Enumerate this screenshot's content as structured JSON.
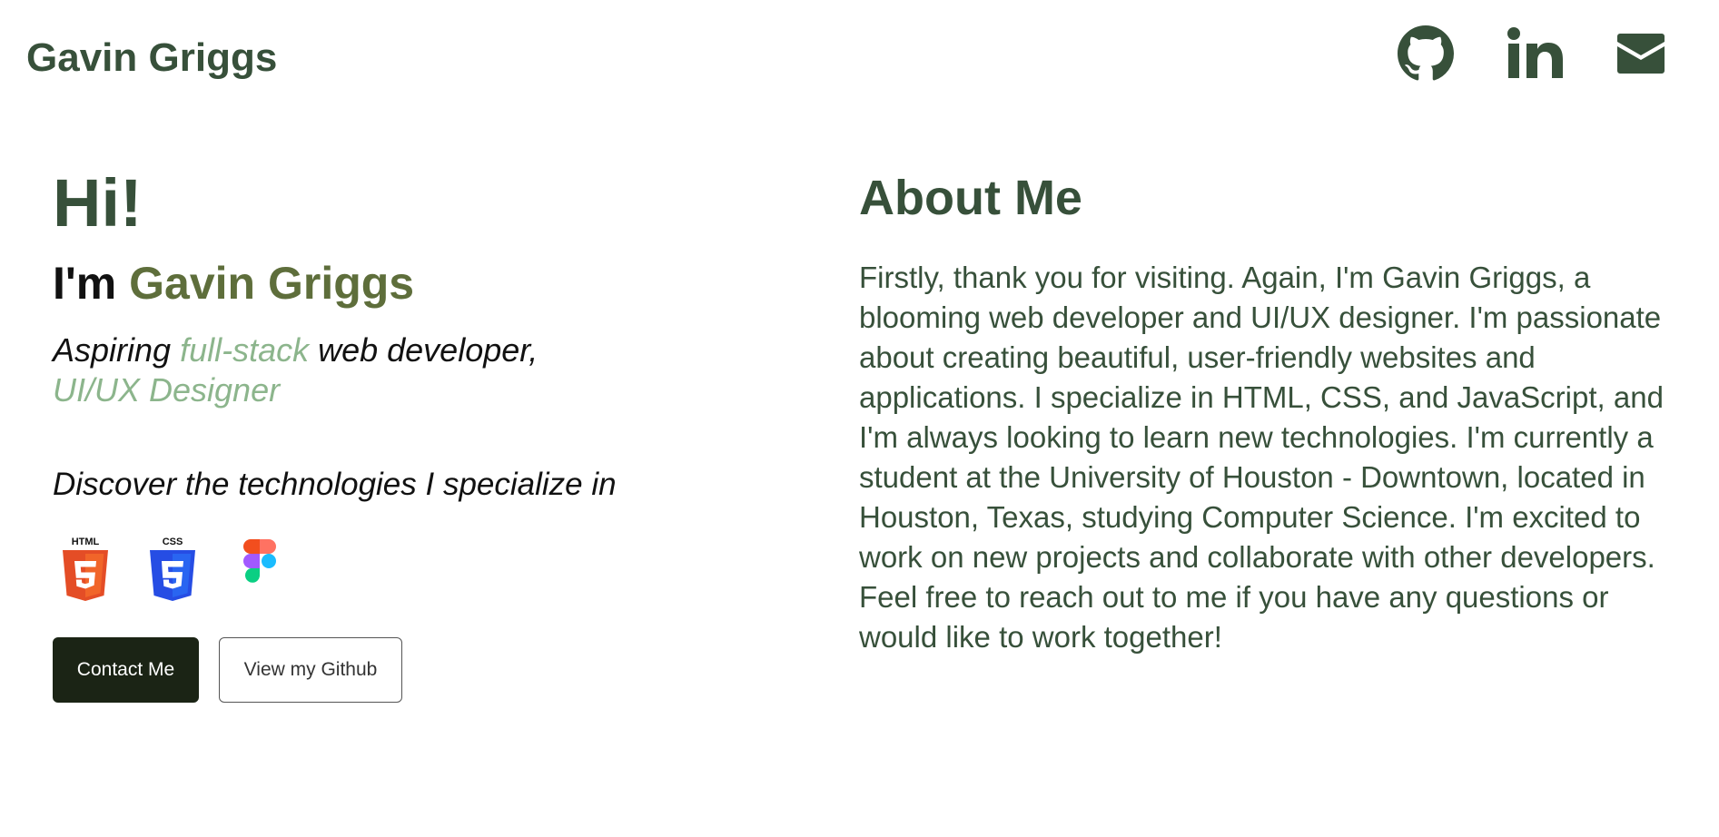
{
  "header": {
    "brand": "Gavin Griggs",
    "social": [
      {
        "icon": "github-icon",
        "label": "GitHub"
      },
      {
        "icon": "linkedin-icon",
        "label": "LinkedIn"
      },
      {
        "icon": "mail-icon",
        "label": "Email"
      }
    ]
  },
  "hero": {
    "greeting": "Hi!",
    "intro_prefix": "I'm ",
    "intro_name": "Gavin Griggs",
    "tagline_part1": "Aspiring ",
    "tagline_highlight": "full-stack",
    "tagline_part2": " web developer,",
    "tagline_line2": "UI/UX Designer",
    "discover": "Discover the technologies I specialize in",
    "technologies": [
      {
        "icon": "html5-icon",
        "label": "HTML"
      },
      {
        "icon": "css3-icon",
        "label": "CSS"
      },
      {
        "icon": "figma-icon",
        "label": "Figma"
      }
    ],
    "contact_button": "Contact Me",
    "github_button": "View my Github"
  },
  "about": {
    "title": "About Me",
    "body": "Firstly, thank you for visiting. Again, I'm Gavin Griggs, a blooming web developer and UI/UX designer. I'm passionate about creating beautiful, user-friendly websites and applications. I specialize in HTML, CSS, and JavaScript, and I'm always looking to learn new technologies. I'm currently a student at the University of Houston - Downtown, located in Houston, Texas, studying Computer Science. I'm excited to work on new projects and collaborate with other developers. Feel free to reach out to me if you have any questions or would like to work together!"
  },
  "colors": {
    "primary_green": "#37503a",
    "name_olive": "#5e6e3b",
    "light_green": "#8cb58c",
    "dark_button": "#1b2415"
  }
}
